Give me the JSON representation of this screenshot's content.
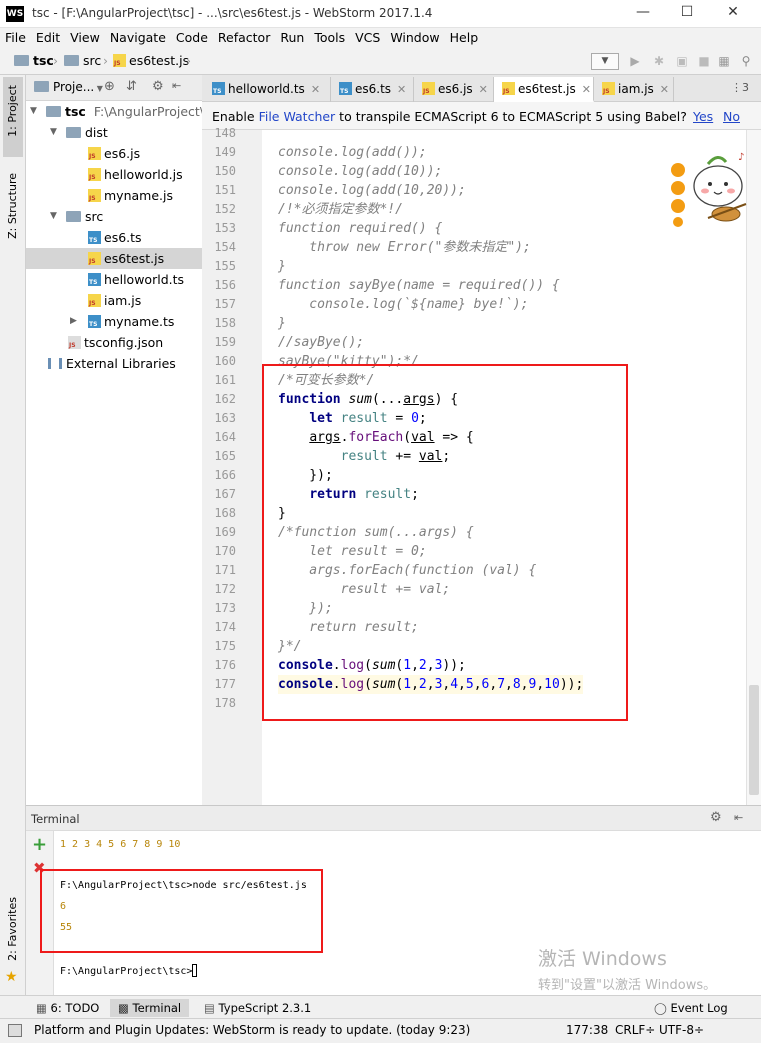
{
  "window": {
    "title": "tsc - [F:\\AngularProject\\tsc] - ...\\src\\es6test.js - WebStorm 2017.1.4",
    "logo": "WS"
  },
  "menu": [
    "File",
    "Edit",
    "View",
    "Navigate",
    "Code",
    "Refactor",
    "Run",
    "Tools",
    "VCS",
    "Window",
    "Help"
  ],
  "breadcrumb": {
    "project": "tsc",
    "folder": "src",
    "file": "es6test.js"
  },
  "sidebar_tabs": {
    "project": "1: Project",
    "structure": "Z: Structure",
    "favorites": "2: Favorites"
  },
  "project_panel": {
    "title": "Proje...",
    "root": "tsc",
    "root_path": "F:\\AngularProject\\t",
    "items": [
      {
        "label": "dist",
        "kind": "folder",
        "depth": 1
      },
      {
        "label": "es6.js",
        "kind": "js",
        "depth": 2
      },
      {
        "label": "helloworld.js",
        "kind": "js",
        "depth": 2
      },
      {
        "label": "myname.js",
        "kind": "js",
        "depth": 2
      },
      {
        "label": "src",
        "kind": "folder",
        "depth": 1
      },
      {
        "label": "es6.ts",
        "kind": "ts",
        "depth": 2
      },
      {
        "label": "es6test.js",
        "kind": "js",
        "depth": 2,
        "selected": true
      },
      {
        "label": "helloworld.ts",
        "kind": "ts",
        "depth": 2
      },
      {
        "label": "iam.js",
        "kind": "js",
        "depth": 2
      },
      {
        "label": "myname.ts",
        "kind": "ts",
        "depth": 2
      },
      {
        "label": "tsconfig.json",
        "kind": "json",
        "depth": 1
      },
      {
        "label": "External Libraries",
        "kind": "lib",
        "depth": 0
      }
    ]
  },
  "editor_tabs": [
    {
      "label": "helloworld.ts",
      "kind": "ts"
    },
    {
      "label": "es6.ts",
      "kind": "ts"
    },
    {
      "label": "es6.js",
      "kind": "js"
    },
    {
      "label": "es6test.js",
      "kind": "js",
      "active": true
    },
    {
      "label": "iam.js",
      "kind": "js"
    }
  ],
  "tabs_overflow": "⋮3",
  "notification": {
    "prefix": "Enable ",
    "link": "File Watcher",
    "suffix": " to transpile ECMAScript 6 to ECMAScript 5 using Babel?",
    "yes": "Yes",
    "no": "No"
  },
  "code_lines": [
    {
      "n": "149",
      "html": "console.log(add());",
      "cls": "cm"
    },
    {
      "n": "150",
      "html": "console.log(add(10));",
      "cls": "cm"
    },
    {
      "n": "151",
      "html": "console.log(add(10,20));",
      "cls": "cm"
    },
    {
      "n": "152",
      "html": "/!*必须指定参数*!/",
      "cls": "cm"
    },
    {
      "n": "153",
      "html": "function required() {",
      "cls": "cm"
    },
    {
      "n": "154",
      "html": "    throw new Error(\"参数未指定\");",
      "cls": "cm"
    },
    {
      "n": "155",
      "html": "}",
      "cls": "cm"
    },
    {
      "n": "156",
      "html": "function sayBye(name = required()) {",
      "cls": "cm"
    },
    {
      "n": "157",
      "html": "    console.log(`${name} bye!`);",
      "cls": "cm"
    },
    {
      "n": "158",
      "html": "}",
      "cls": "cm"
    },
    {
      "n": "159",
      "html": "//sayBye();",
      "cls": "cm"
    },
    {
      "n": "160",
      "html": "sayBye(\"kitty\");*/",
      "cls": "cm"
    },
    {
      "n": "161",
      "html": "/*可变长参数*/",
      "cls": "cm"
    },
    {
      "n": "162",
      "parts": [
        [
          "kw",
          "function "
        ],
        [
          "fn",
          "sum"
        ],
        [
          "",
          "(..."
        ],
        [
          "u",
          "args"
        ],
        [
          "",
          ") {"
        ]
      ]
    },
    {
      "n": "163",
      "parts": [
        [
          "",
          "    "
        ],
        [
          "kw",
          "let "
        ],
        [
          "var",
          "result"
        ],
        [
          "",
          " = "
        ],
        [
          "num",
          "0"
        ],
        [
          "",
          ";"
        ]
      ]
    },
    {
      "n": "164",
      "parts": [
        [
          "",
          "    "
        ],
        [
          "u",
          "args"
        ],
        [
          "",
          "."
        ],
        [
          "prop",
          "forEach"
        ],
        [
          "",
          "("
        ],
        [
          "u",
          "val"
        ],
        [
          "",
          " => {"
        ]
      ]
    },
    {
      "n": "165",
      "parts": [
        [
          "",
          "        "
        ],
        [
          "var",
          "result"
        ],
        [
          "",
          " += "
        ],
        [
          "u",
          "val"
        ],
        [
          "",
          ";"
        ]
      ]
    },
    {
      "n": "166",
      "parts": [
        [
          "",
          "    });"
        ]
      ]
    },
    {
      "n": "167",
      "parts": [
        [
          "",
          "    "
        ],
        [
          "kw",
          "return "
        ],
        [
          "var",
          "result"
        ],
        [
          "",
          ";"
        ]
      ]
    },
    {
      "n": "168",
      "parts": [
        [
          "",
          "}"
        ]
      ]
    },
    {
      "n": "169",
      "html": "/*function sum(...args) {",
      "cls": "cm"
    },
    {
      "n": "170",
      "html": "    let result = 0;",
      "cls": "cm"
    },
    {
      "n": "171",
      "html": "    args.forEach(function (val) {",
      "cls": "cm"
    },
    {
      "n": "172",
      "html": "        result += val;",
      "cls": "cm"
    },
    {
      "n": "173",
      "html": "    });",
      "cls": "cm"
    },
    {
      "n": "174",
      "html": "    return result;",
      "cls": "cm"
    },
    {
      "n": "175",
      "html": "}*/",
      "cls": "cm"
    },
    {
      "n": "176",
      "parts": [
        [
          "kw",
          "console"
        ],
        [
          "",
          "."
        ],
        [
          "prop",
          "log"
        ],
        [
          "",
          "("
        ],
        [
          "fn",
          "sum"
        ],
        [
          "",
          "("
        ],
        [
          "num",
          "1"
        ],
        [
          "",
          ","
        ],
        [
          "num",
          "2"
        ],
        [
          "",
          ","
        ],
        [
          "num",
          "3"
        ],
        [
          "",
          "));"
        ]
      ]
    },
    {
      "n": "177",
      "parts": [
        [
          "kw",
          "console"
        ],
        [
          "",
          "."
        ],
        [
          "prop",
          "log"
        ],
        [
          "",
          "("
        ],
        [
          "fn",
          "sum"
        ],
        [
          "",
          "("
        ],
        [
          "num",
          "1"
        ],
        [
          "",
          ","
        ],
        [
          "num",
          "2"
        ],
        [
          "",
          ","
        ],
        [
          "num",
          "3"
        ],
        [
          "",
          ","
        ],
        [
          "num",
          "4"
        ],
        [
          "",
          ","
        ],
        [
          "num",
          "5"
        ],
        [
          "",
          ","
        ],
        [
          "num",
          "6"
        ],
        [
          "",
          ","
        ],
        [
          "num",
          "7"
        ],
        [
          "",
          ","
        ],
        [
          "num",
          "8"
        ],
        [
          "",
          ","
        ],
        [
          "num",
          "9"
        ],
        [
          "",
          ","
        ],
        [
          "num",
          "10"
        ],
        [
          "",
          "));"
        ]
      ]
    },
    {
      "n": "178",
      "parts": []
    }
  ],
  "partial_line_number": "148",
  "terminal": {
    "title": "Terminal",
    "lines": [
      {
        "text": "1 2 3 4 5 6 7 8 9 10",
        "color": "#b8860b"
      },
      {
        "text": "F:\\AngularProject\\tsc>node src/es6test.js",
        "color": "#000000"
      },
      {
        "text": "6",
        "color": "#b8860b"
      },
      {
        "text": "55",
        "color": "#b8860b"
      },
      {
        "text": "F:\\AngularProject\\tsc>",
        "color": "#000000"
      }
    ]
  },
  "bottom_tools": {
    "todo": "6: TODO",
    "terminal": "Terminal",
    "typescript": "TypeScript 2.3.1",
    "event_log": "Event Log"
  },
  "status": {
    "message": "Platform and Plugin Updates: WebStorm is ready to update. (today 9:23)",
    "position": "177:38",
    "line_sep": "CRLF÷",
    "encoding": "UTF-8÷"
  },
  "watermark": {
    "line1": "激活 Windows",
    "line2": "转到\"设置\"以激活 Windows。"
  },
  "colors": {
    "highlight_box": "#ee1a1a",
    "keyword": "#000080",
    "comment": "#808080",
    "number": "#0000ff"
  }
}
